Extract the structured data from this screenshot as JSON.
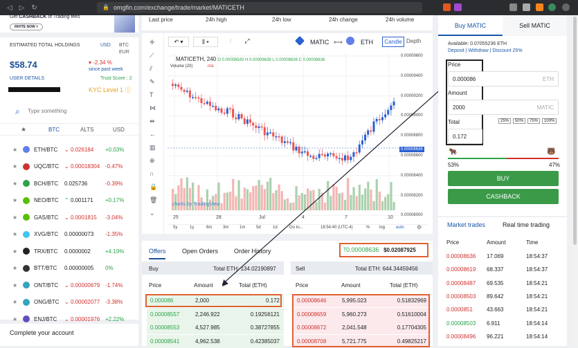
{
  "browser": {
    "url": "omgfin.com/exchange/trade/market/MATICETH"
  },
  "promo": {
    "text_pre": "Get",
    "text_bold": "CASHBACK",
    "text_post": "of Trading fees",
    "invite": "INVITE NOW >"
  },
  "holdings": {
    "label": "ESTIMATED TOTAL HOLDINGS",
    "cur1": "USD",
    "cur2": "BTC",
    "cur3": "EUR",
    "value": "$58.74",
    "change": "-2.34 %",
    "change_note": "since past week",
    "user_details": "USER DETAILS",
    "trust": "Trust Score : 2",
    "kyc": "KYC Level 1"
  },
  "search": {
    "placeholder": "Type something"
  },
  "market_tabs": [
    "BTC",
    "ALTS",
    "USD"
  ],
  "coins": [
    {
      "pair": "ETH/BTC",
      "price": "0.026184",
      "change": "+0.03%",
      "dir": "down",
      "color": "#627eea",
      "chcolor": "grn"
    },
    {
      "pair": "UQC/BTC",
      "price": "0.00018304",
      "change": "-0.47%",
      "dir": "down",
      "color": "#c33",
      "chcolor": "red"
    },
    {
      "pair": "BCH/BTC",
      "price": "0.025736",
      "change": "-0.39%",
      "dir": "none",
      "color": "#2aa34a",
      "chcolor": "red"
    },
    {
      "pair": "NEO/BTC",
      "price": "0.001171",
      "change": "+0.17%",
      "dir": "up",
      "color": "#58bf00",
      "chcolor": "grn"
    },
    {
      "pair": "GAS/BTC",
      "price": "0.0001815",
      "change": "-3.04%",
      "dir": "down",
      "color": "#58bf00",
      "chcolor": "red"
    },
    {
      "pair": "XVG/BTC",
      "price": "0.00000073",
      "change": "-1.35%",
      "dir": "none",
      "color": "#40c4f0",
      "chcolor": "red"
    },
    {
      "pair": "TRX/BTC",
      "price": "0.0000002",
      "change": "+4.19%",
      "dir": "none",
      "color": "#222",
      "chcolor": "grn"
    },
    {
      "pair": "BTT/BTC",
      "price": "0.00000005",
      "change": "0%",
      "dir": "none",
      "color": "#333",
      "chcolor": "grn"
    },
    {
      "pair": "ONT/BTC",
      "price": "0.00000679",
      "change": "-1.74%",
      "dir": "down",
      "color": "#32a4be",
      "chcolor": "red"
    },
    {
      "pair": "ONG/BTC",
      "price": "0.00002077",
      "change": "-3.38%",
      "dir": "down",
      "color": "#32a4be",
      "chcolor": "red"
    },
    {
      "pair": "ENJ/BTC",
      "price": "0.00001976",
      "change": "+2.22%",
      "dir": "down",
      "color": "#624dbf",
      "chcolor": "grn"
    }
  ],
  "complete": "Complete your account",
  "stats": [
    "Last price",
    "24h high",
    "24h low",
    "24h change",
    "24h volume"
  ],
  "chart": {
    "symbol": "MATICETH, 240",
    "ohlc": {
      "o": "0.00008543",
      "h": "0.00008638",
      "l": "0.00008636",
      "c": "0.00008636"
    },
    "volume": "Volume (20)",
    "na": "n/a",
    "base": "MATIC",
    "quote": "ETH",
    "view1": "Candle",
    "view2": "Depth",
    "price_tag": "0.00008636",
    "credit": "charts by TradingView",
    "yticks": [
      "0.00009600",
      "0.00009400",
      "0.00009200",
      "0.00009000",
      "0.00008800",
      "0.00008600",
      "0.00008400",
      "0.00008200",
      "0.00008000"
    ],
    "xticks": [
      "25",
      "28",
      "Jul",
      "4",
      "7",
      "10"
    ],
    "ranges": [
      "5y",
      "1y",
      "6m",
      "3m",
      "1m",
      "5d",
      "1d",
      "Go to..."
    ],
    "time": "18:54:40 (UTC-4)",
    "pct": "%",
    "log": "log",
    "auto": "auto"
  },
  "offers": {
    "tabs": [
      "Offers",
      "Open Orders",
      "Order History"
    ],
    "last": "0.00008636",
    "usd": "$0.02087925",
    "buy": {
      "title": "Buy",
      "total": "Total ETH: 134.02190897",
      "cols": [
        "Price",
        "Amount",
        "Total (ETH)"
      ],
      "rows": [
        [
          "0.000086",
          "2,000",
          "0.172"
        ],
        [
          "0.00008557",
          "2,246.922",
          "0.19256121"
        ],
        [
          "0.00008553",
          "4,527.985",
          "0.38727855"
        ],
        [
          "0.00008541",
          "4,962.538",
          "0.42385037"
        ]
      ]
    },
    "sell": {
      "title": "Sell",
      "total": "Total ETH: 644.34459456",
      "cols": [
        "Price",
        "Amount",
        "Total (ETH)"
      ],
      "rows": [
        [
          "0.00008646",
          "5,995.023",
          "0.51832969"
        ],
        [
          "0.00008659",
          "5,960.273",
          "0.51610004"
        ],
        [
          "0.00008672",
          "2,041.548",
          "0.17704305"
        ],
        [
          "0.00008708",
          "5,721.775",
          "0.49825217"
        ]
      ]
    }
  },
  "trade": {
    "tab_buy": "Buy MATIC",
    "tab_sell": "Sell MATIC",
    "available": "Available: 0.07055236 ETH",
    "links": [
      "Deposit",
      "Withdraw",
      "Discount 25%"
    ],
    "price_label": "Price",
    "price": "0.000086",
    "price_unit": "ETH",
    "amount_label": "Amount",
    "amount": "2000",
    "amount_unit": "MATIC",
    "total_label": "Total",
    "total": "0.172",
    "pcts": [
      "25%",
      "50%",
      "75%",
      "100%"
    ],
    "bull": "53%",
    "bear": "47%",
    "buy": "BUY",
    "cashback": "CASHBACK"
  },
  "mtrades": {
    "tab1": "Market trades",
    "tab2": "Real time trading",
    "cols": [
      "Price",
      "Amount",
      "Time"
    ],
    "rows": [
      [
        "0.00008636",
        "17.069",
        "18:54:37",
        "red"
      ],
      [
        "0.00008619",
        "68.337",
        "18:54:37",
        "red"
      ],
      [
        "0.00008487",
        "69.535",
        "18:54:21",
        "red"
      ],
      [
        "0.00008503",
        "89.642",
        "18:54:21",
        "red"
      ],
      [
        "0.0000851",
        "43.663",
        "18:54:21",
        "red"
      ],
      [
        "0.00008503",
        "6.911",
        "18:54:14",
        "grn"
      ],
      [
        "0.00008496",
        "96.221",
        "18:54:14",
        "red"
      ]
    ]
  }
}
